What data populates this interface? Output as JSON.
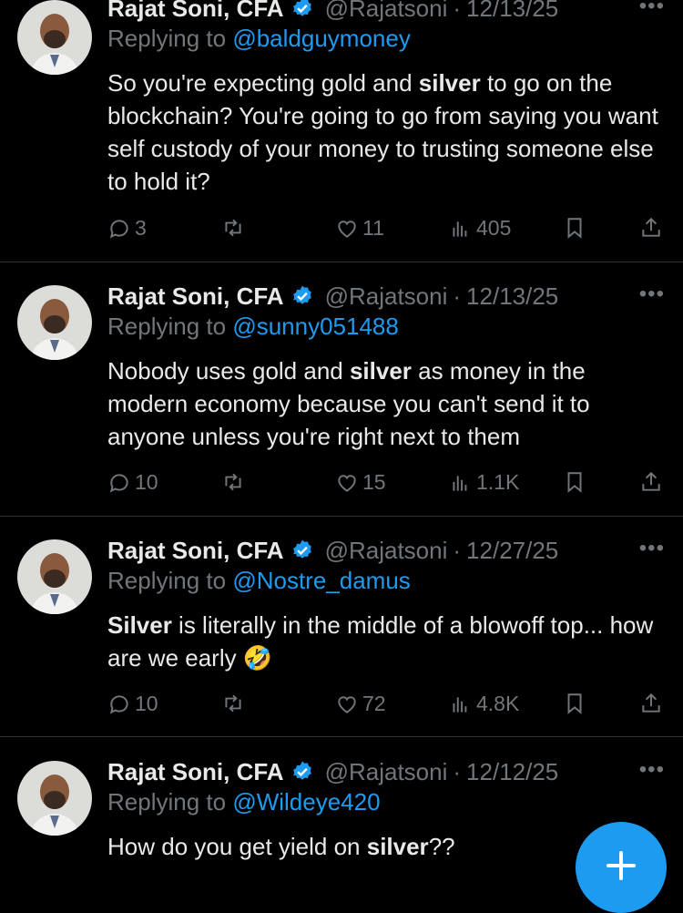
{
  "tweets": [
    {
      "name": "Rajat Soni, CFA",
      "handle": "@Rajatsoni",
      "date": "12/13/25",
      "replying_prefix": "Replying to",
      "replying_to": "@baldguymoney",
      "body": [
        {
          "t": "So you're expecting gold and ",
          "b": false
        },
        {
          "t": "silver",
          "b": true
        },
        {
          "t": " to go on the blockchain? You're going to go from saying you want self custody of your money to trusting someone else to hold it?",
          "b": false
        }
      ],
      "replies": "3",
      "reposts": "",
      "likes": "11",
      "views": "405"
    },
    {
      "name": "Rajat Soni, CFA",
      "handle": "@Rajatsoni",
      "date": "12/13/25",
      "replying_prefix": "Replying to",
      "replying_to": "@sunny051488",
      "body": [
        {
          "t": "Nobody uses gold and ",
          "b": false
        },
        {
          "t": "silver",
          "b": true
        },
        {
          "t": " as money in the modern economy because you can't send it to anyone unless you're right next to them",
          "b": false
        }
      ],
      "replies": "10",
      "reposts": "",
      "likes": "15",
      "views": "1.1K"
    },
    {
      "name": "Rajat Soni, CFA",
      "handle": "@Rajatsoni",
      "date": "12/27/25",
      "replying_prefix": "Replying to",
      "replying_to": "@Nostre_damus",
      "body": [
        {
          "t": "Silver",
          "b": true
        },
        {
          "t": " is literally in the middle of a blowoff top... how are we early 🤣",
          "b": false
        }
      ],
      "replies": "10",
      "reposts": "",
      "likes": "72",
      "views": "4.8K"
    },
    {
      "name": "Rajat Soni, CFA",
      "handle": "@Rajatsoni",
      "date": "12/12/25",
      "replying_prefix": "Replying to",
      "replying_to": "@Wildeye420",
      "body": [
        {
          "t": "How do you get yield on ",
          "b": false
        },
        {
          "t": "silver",
          "b": true
        },
        {
          "t": "??",
          "b": false
        }
      ],
      "replies": "",
      "reposts": "",
      "likes": "",
      "views": ""
    }
  ],
  "colors": {
    "accent": "#1d9bf0",
    "muted": "#71767b",
    "text": "#e7e9ea",
    "divider": "#2f3336"
  },
  "icons": [
    "verified-badge-icon",
    "more-icon",
    "reply-icon",
    "repost-icon",
    "like-icon",
    "views-icon",
    "bookmark-icon",
    "share-icon",
    "compose-plus-icon"
  ]
}
